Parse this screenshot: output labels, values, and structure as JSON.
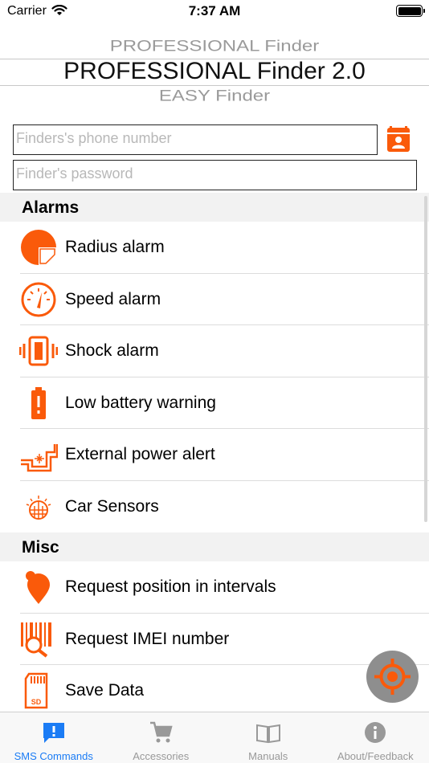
{
  "status_bar": {
    "carrier": "Carrier",
    "time": "7:37 AM"
  },
  "picker": {
    "previous": "PROFESSIONAL Finder",
    "selected": "PROFESSIONAL Finder 2.0",
    "next": "EASY Finder"
  },
  "form": {
    "phone_placeholder": "Finders's phone number",
    "password_placeholder": "Finder's password"
  },
  "sections": {
    "alarms": {
      "title": "Alarms",
      "items": [
        {
          "label": "Radius alarm",
          "icon": "radius-icon"
        },
        {
          "label": "Speed alarm",
          "icon": "speedometer-icon"
        },
        {
          "label": "Shock alarm",
          "icon": "vibration-icon"
        },
        {
          "label": "Low battery warning",
          "icon": "battery-low-icon"
        },
        {
          "label": "External power alert",
          "icon": "power-alert-icon"
        },
        {
          "label": "Car Sensors",
          "icon": "car-sensor-icon"
        }
      ]
    },
    "misc": {
      "title": "Misc",
      "items": [
        {
          "label": "Request position in intervals",
          "icon": "location-pin-icon"
        },
        {
          "label": "Request IMEI number",
          "icon": "barcode-search-icon"
        },
        {
          "label": "Save Data",
          "icon": "sd-card-icon"
        }
      ]
    }
  },
  "tabbar": {
    "tabs": [
      {
        "label": "SMS Commands",
        "icon": "sms-icon",
        "active": true
      },
      {
        "label": "Accessories",
        "icon": "cart-icon",
        "active": false
      },
      {
        "label": "Manuals",
        "icon": "book-icon",
        "active": false
      },
      {
        "label": "About/Feedback",
        "icon": "info-icon",
        "active": false
      }
    ]
  },
  "colors": {
    "accent": "#fa5a0a",
    "tab_active": "#1b7cf5",
    "tab_inactive": "#999999",
    "section_bg": "#f2f2f2"
  }
}
